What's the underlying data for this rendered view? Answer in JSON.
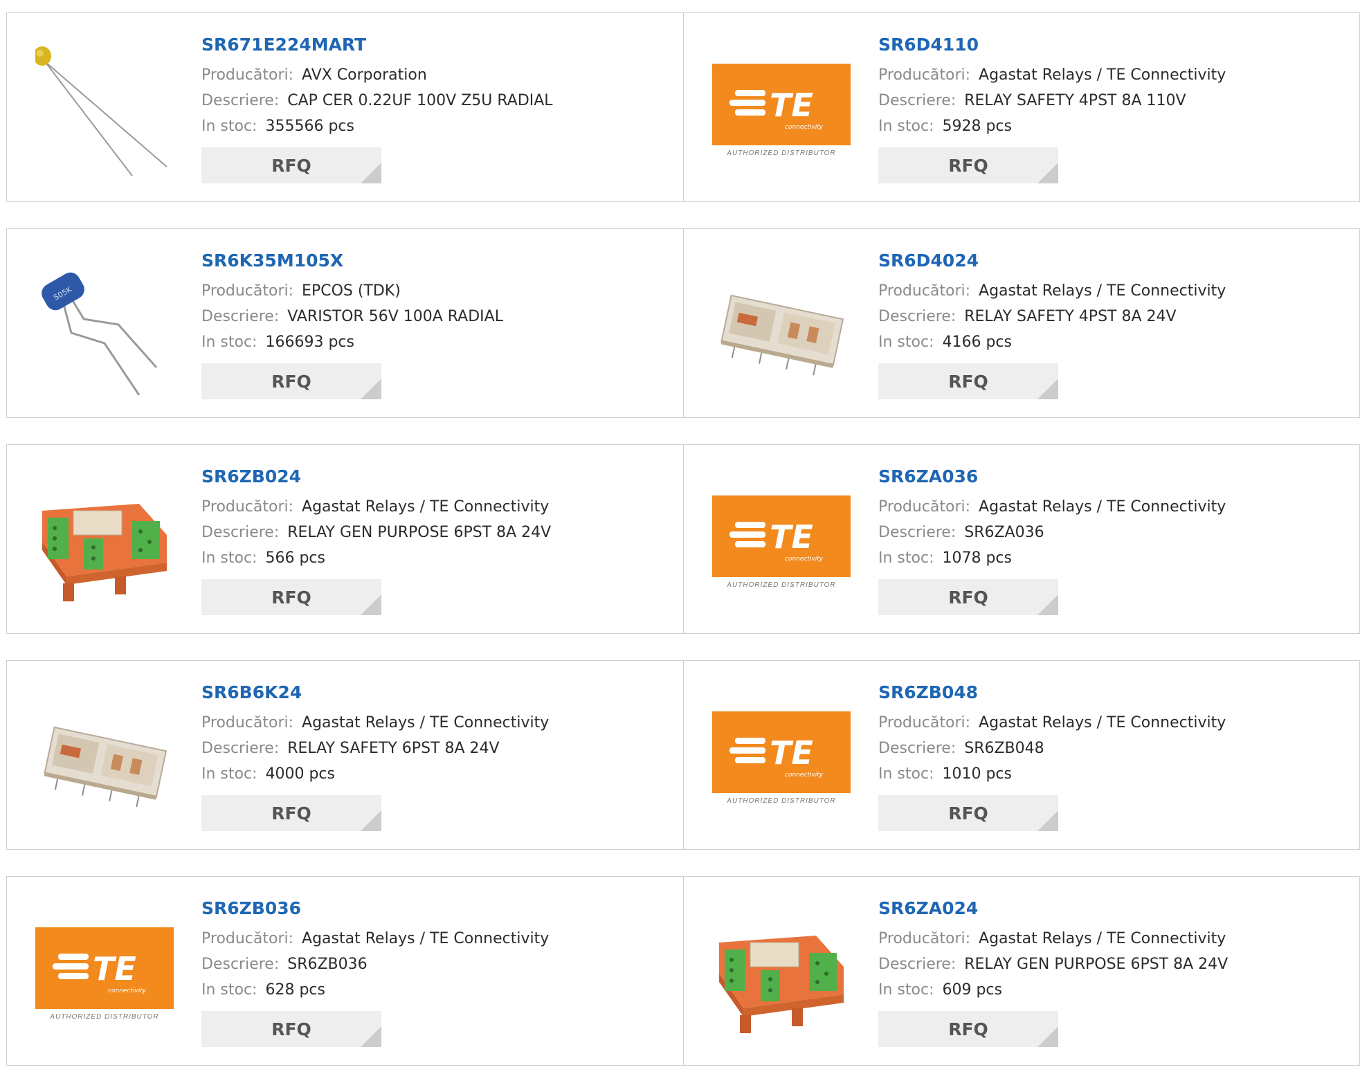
{
  "labels": {
    "manufacturer": "Producători:",
    "description": "Descriere:",
    "stock": "In stoc:",
    "rfq": "RFQ",
    "authorized": "AUTHORIZED DISTRIBUTOR",
    "te_sub": "connectivity"
  },
  "colors": {
    "link": "#1f66b3",
    "te_orange": "#f28a1e",
    "button_bg": "#eeeeee"
  },
  "products": [
    {
      "part": "SR671E224MART",
      "manufacturer": "AVX Corporation",
      "description": "CAP CER 0.22UF 100V Z5U RADIAL",
      "stock": "355566 pcs",
      "image": "ceramic-capacitor"
    },
    {
      "part": "SR6D4110",
      "manufacturer": "Agastat Relays / TE Connectivity",
      "description": "RELAY SAFETY 4PST 8A 110V",
      "stock": "5928 pcs",
      "image": "te-logo"
    },
    {
      "part": "SR6K35M105X",
      "manufacturer": "EPCOS (TDK)",
      "description": "VARISTOR 56V 100A RADIAL",
      "stock": "166693 pcs",
      "image": "varistor"
    },
    {
      "part": "SR6D4024",
      "manufacturer": "Agastat Relays / TE Connectivity",
      "description": "RELAY SAFETY 4PST 8A 24V",
      "stock": "4166 pcs",
      "image": "safety-relay"
    },
    {
      "part": "SR6ZB024",
      "manufacturer": "Agastat Relays / TE Connectivity",
      "description": "RELAY GEN PURPOSE 6PST 8A 24V",
      "stock": "566 pcs",
      "image": "relay-module"
    },
    {
      "part": "SR6ZA036",
      "manufacturer": "Agastat Relays / TE Connectivity",
      "description": "SR6ZA036",
      "stock": "1078 pcs",
      "image": "te-logo"
    },
    {
      "part": "SR6B6K24",
      "manufacturer": "Agastat Relays / TE Connectivity",
      "description": "RELAY SAFETY 6PST 8A 24V",
      "stock": "4000 pcs",
      "image": "safety-relay"
    },
    {
      "part": "SR6ZB048",
      "manufacturer": "Agastat Relays / TE Connectivity",
      "description": "SR6ZB048",
      "stock": "1010 pcs",
      "image": "te-logo"
    },
    {
      "part": "SR6ZB036",
      "manufacturer": "Agastat Relays / TE Connectivity",
      "description": "SR6ZB036",
      "stock": "628 pcs",
      "image": "te-logo"
    },
    {
      "part": "SR6ZA024",
      "manufacturer": "Agastat Relays / TE Connectivity",
      "description": "RELAY GEN PURPOSE 6PST 8A 24V",
      "stock": "609 pcs",
      "image": "relay-module"
    }
  ]
}
